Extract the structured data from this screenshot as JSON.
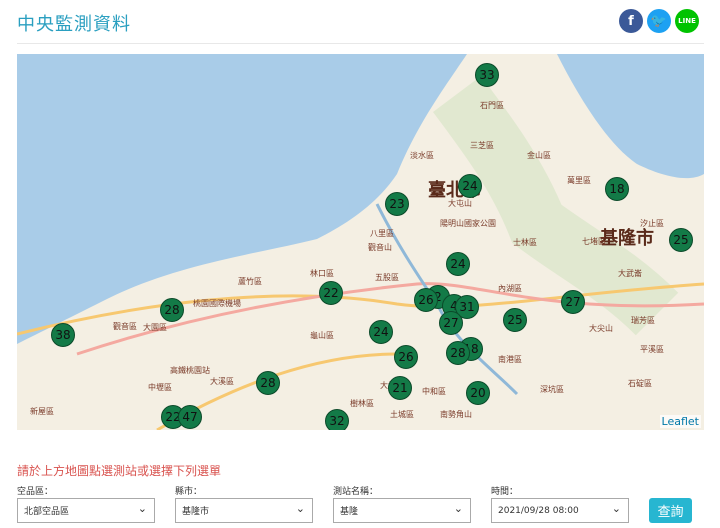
{
  "header": {
    "title": "中央監測資料",
    "social": [
      {
        "icon": "facebook-icon",
        "label": "f"
      },
      {
        "icon": "twitter-icon",
        "label": "t"
      },
      {
        "icon": "line-icon",
        "label": "LINE"
      }
    ]
  },
  "map": {
    "cities": [
      "臺北市",
      "基隆市"
    ],
    "places": [
      "石門區",
      "三芝區",
      "淡水區",
      "金山區",
      "萬里區",
      "大屯山",
      "陽明山國家公園",
      "八里區",
      "觀音山",
      "士林區",
      "七堵區",
      "汐止區",
      "大武崙",
      "瑞芳區",
      "林口區",
      "五股區",
      "蘆竹區",
      "大園區",
      "桃園國際機場",
      "觀音區",
      "內湖區",
      "大尖山",
      "龜山區",
      "南港區",
      "中壢區",
      "平溪區",
      "新屋區",
      "大棟山",
      "樹林區",
      "中和區",
      "深坑區",
      "石碇區",
      "土城區",
      "南勢角山",
      "高鐵桃園站",
      "大溪區"
    ],
    "markers": [
      "33",
      "24",
      "18",
      "23",
      "25",
      "24",
      "22",
      "28",
      "27",
      "2",
      "26",
      "4",
      "31",
      "27",
      "25",
      "24",
      "38",
      "26",
      "18",
      "28",
      "28",
      "21",
      "20",
      "22",
      "47",
      "32"
    ],
    "attribution": "Leaflet"
  },
  "form": {
    "hint": "請於上方地圖點選測站或選擇下列選單",
    "fields": [
      {
        "label": "空品區：",
        "value": "北部空品區"
      },
      {
        "label": "縣市：",
        "value": "基隆市"
      },
      {
        "label": "測站名稱：",
        "value": "基隆"
      },
      {
        "label": "時間：",
        "value": "2021/09/28 08:00"
      }
    ],
    "submit": "查詢"
  }
}
